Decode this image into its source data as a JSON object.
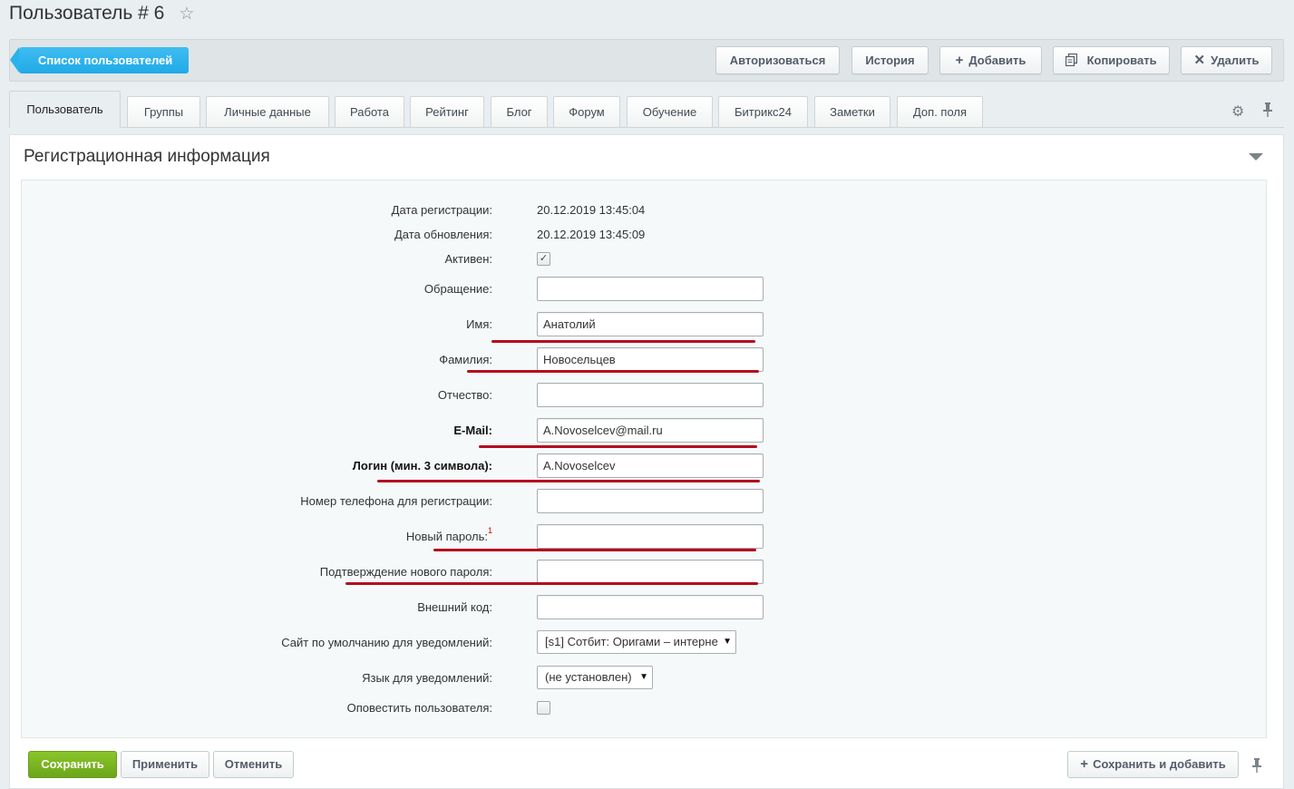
{
  "header": {
    "title": "Пользователь # 6",
    "star_icon": "☆"
  },
  "toolbar": {
    "back_label": "Список пользователей",
    "authorize_label": "Авторизоваться",
    "history_label": "История",
    "add_label": "Добавить",
    "copy_label": "Копировать",
    "delete_label": "Удалить"
  },
  "tabs": [
    {
      "label": "Пользователь",
      "active": true
    },
    {
      "label": "Группы"
    },
    {
      "label": "Личные данные"
    },
    {
      "label": "Работа"
    },
    {
      "label": "Рейтинг"
    },
    {
      "label": "Блог"
    },
    {
      "label": "Форум"
    },
    {
      "label": "Обучение"
    },
    {
      "label": "Битрикс24"
    },
    {
      "label": "Заметки"
    },
    {
      "label": "Доп. поля"
    }
  ],
  "section": {
    "title": "Регистрационная информация"
  },
  "form": {
    "reg_date_label": "Дата регистрации:",
    "reg_date": "20.12.2019 13:45:04",
    "upd_date_label": "Дата обновления:",
    "upd_date": "20.12.2019 13:45:09",
    "active_label": "Активен:",
    "active_checked": "✓",
    "title_label": "Обращение:",
    "title_value": "",
    "name_label": "Имя:",
    "name_value": "Анатолий",
    "last_name_label": "Фамилия:",
    "last_name_value": "Новосельцев",
    "second_name_label": "Отчество:",
    "second_name_value": "",
    "email_label": "E-Mail:",
    "email_value": "A.Novoselcev@mail.ru",
    "login_label": "Логин (мин. 3 символа):",
    "login_value": "A.Novoselcev",
    "phone_label": "Номер телефона для регистрации:",
    "phone_value": "",
    "new_password_label": "Новый пароль:",
    "new_password_sup": "1",
    "new_password_value": "",
    "confirm_password_label": "Подтверждение нового пароля:",
    "confirm_password_value": "",
    "external_code_label": "Внешний код:",
    "external_code_value": "",
    "site_label": "Сайт по умолчанию для уведомлений:",
    "site_value": "[s1] Сотбит: Оригами – интерне",
    "lang_label": "Язык для уведомлений:",
    "lang_value": "(не установлен)",
    "notify_label": "Оповестить пользователя:"
  },
  "footer": {
    "save_label": "Сохранить",
    "apply_label": "Применить",
    "cancel_label": "Отменить",
    "save_add_label": "Сохранить и добавить"
  },
  "colors": {
    "accent_blue": "#1faae6",
    "save_green": "#7bb622",
    "annotation_red": "#b40a1e"
  }
}
